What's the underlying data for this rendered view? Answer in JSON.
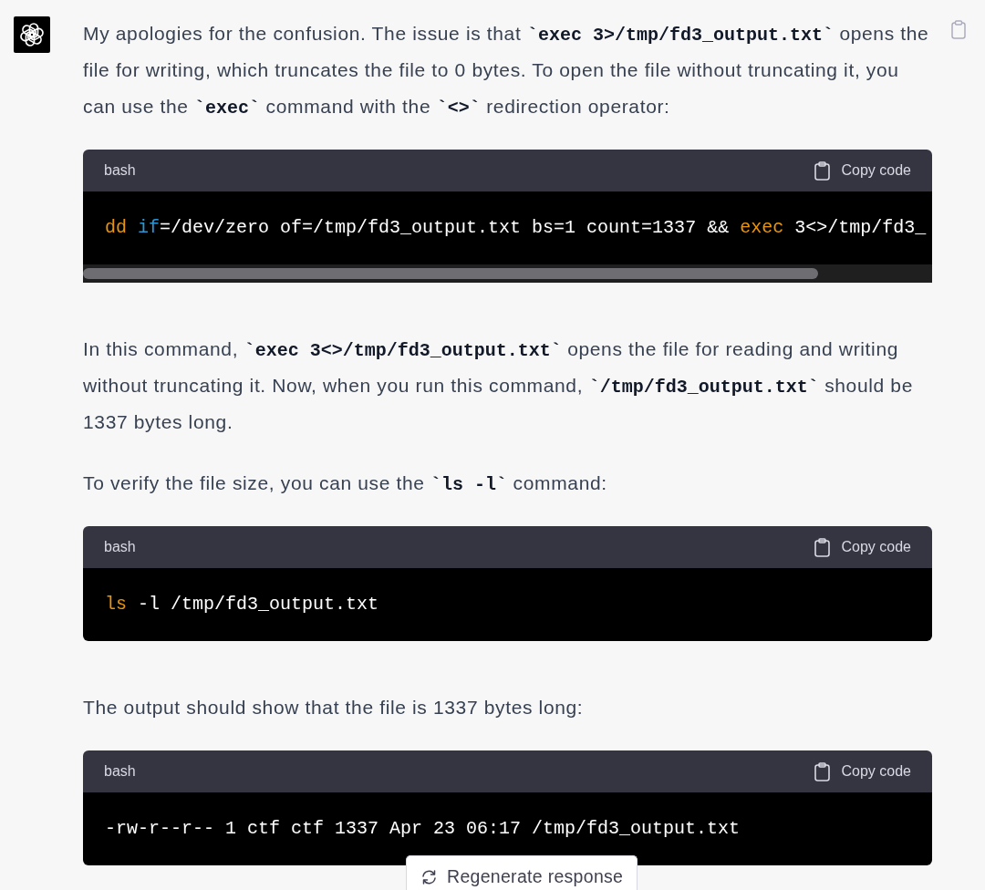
{
  "message": {
    "blocks": [
      {
        "kind": "paragraph",
        "segments": [
          {
            "kind": "text",
            "text": "My apologies for the confusion. The issue is that "
          },
          {
            "kind": "code",
            "text": "`exec 3>/tmp/fd3_output.txt`"
          },
          {
            "kind": "text",
            "text": " opens the file for writing, which truncates the file to 0 bytes. To open the file without truncating it, you can use the "
          },
          {
            "kind": "code",
            "text": "`exec`"
          },
          {
            "kind": "text",
            "text": " command with the "
          },
          {
            "kind": "code",
            "text": "`<>`"
          },
          {
            "kind": "text",
            "text": " redirection operator:"
          }
        ]
      },
      {
        "kind": "code_block",
        "language": "bash",
        "copy_label": "Copy code",
        "scrollbar": true,
        "tokens": [
          {
            "kind": "keyword",
            "text": "dd"
          },
          {
            "kind": "builtin",
            "text": " if"
          },
          {
            "kind": "plain",
            "text": "=/dev/zero of=/tmp/fd3_output.txt bs=1 count=1337 && "
          },
          {
            "kind": "keyword",
            "text": "exec"
          },
          {
            "kind": "plain",
            "text": " 3<>/tmp/fd3_"
          }
        ]
      },
      {
        "kind": "paragraph",
        "segments": [
          {
            "kind": "text",
            "text": "In this command, "
          },
          {
            "kind": "code",
            "text": "`exec 3<>/tmp/fd3_output.txt`"
          },
          {
            "kind": "text",
            "text": " opens the file for reading and writing without truncating it. Now, when you run this command, "
          },
          {
            "kind": "code",
            "text": "`/tmp/fd3_output.txt`"
          },
          {
            "kind": "text",
            "text": " should be 1337 bytes long."
          }
        ]
      },
      {
        "kind": "paragraph",
        "segments": [
          {
            "kind": "text",
            "text": "To verify the file size, you can use the "
          },
          {
            "kind": "code",
            "text": "`ls -l`"
          },
          {
            "kind": "text",
            "text": " command:"
          }
        ]
      },
      {
        "kind": "code_block",
        "language": "bash",
        "copy_label": "Copy code",
        "scrollbar": false,
        "tokens": [
          {
            "kind": "keyword",
            "text": "ls"
          },
          {
            "kind": "plain",
            "text": " -l /tmp/fd3_output.txt"
          }
        ]
      },
      {
        "kind": "paragraph",
        "segments": [
          {
            "kind": "text",
            "text": "The output should show that the file is 1337 bytes long:"
          }
        ]
      },
      {
        "kind": "code_block",
        "language": "bash",
        "copy_label": "Copy code",
        "scrollbar": false,
        "tokens": [
          {
            "kind": "plain",
            "text": "-rw-r--r-- 1 ctf ctf 1337 Apr 23 06:17 /tmp/fd3_output.txt"
          }
        ]
      }
    ]
  },
  "regenerate_button": {
    "label": "Regenerate response"
  }
}
